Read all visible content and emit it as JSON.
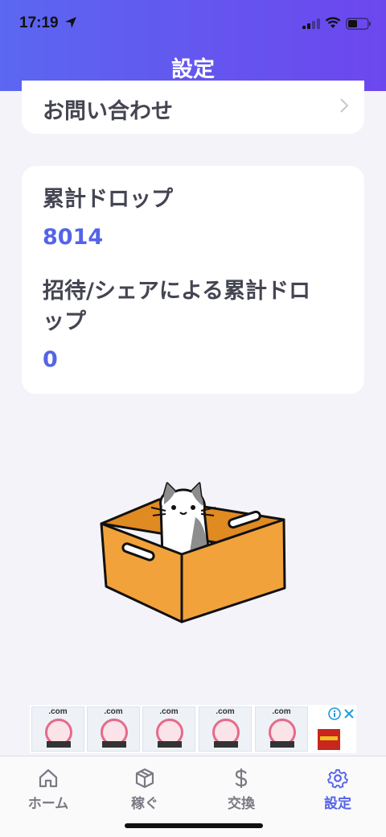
{
  "status_bar": {
    "time": "17:19"
  },
  "header": {
    "title": "設定"
  },
  "contact": {
    "label": "お問い合わせ"
  },
  "stats": [
    {
      "label": "累計ドロップ",
      "value": "8014"
    },
    {
      "label_line1": "招待/シェアによる累計ドロ",
      "label_line2": "ップ",
      "value": "0"
    }
  ],
  "ad": {
    "thumb_text": ".com",
    "thumbs": [
      ".com",
      ".com",
      ".com",
      ".com",
      ".com"
    ]
  },
  "tabs": [
    {
      "label": "ホーム",
      "icon": "home-icon",
      "active": false
    },
    {
      "label": "稼ぐ",
      "icon": "box-icon",
      "active": false
    },
    {
      "label": "交換",
      "icon": "dollar-icon",
      "active": false
    },
    {
      "label": "設定",
      "icon": "gear-icon",
      "active": true
    }
  ],
  "colors": {
    "accent": "#5563e8",
    "header_start": "#5b67f0",
    "header_end": "#6c47ee",
    "box": "#f2a23a"
  }
}
